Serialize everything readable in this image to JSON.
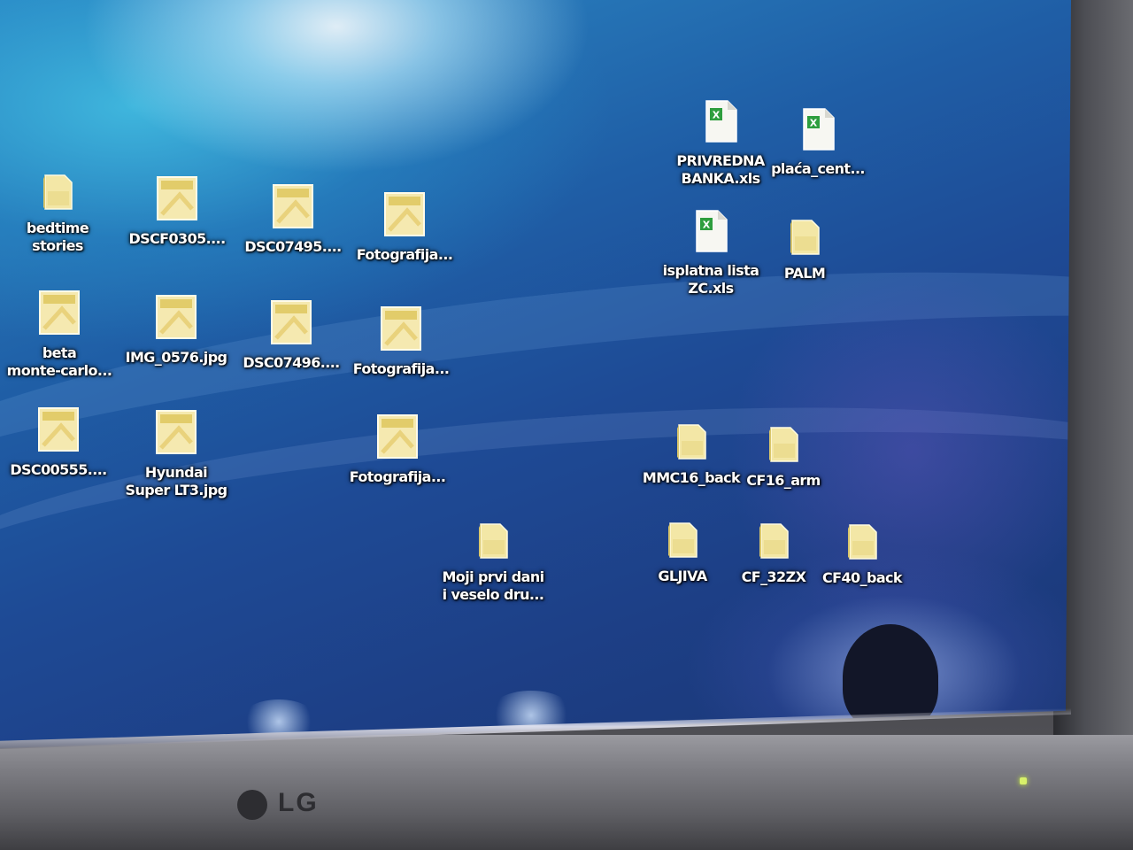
{
  "desktop": {
    "icons": [
      {
        "label": "bedtime\nstories",
        "type": "folder",
        "icon": "folder-icon"
      },
      {
        "label": "DSCF0305....",
        "type": "image",
        "icon": "image-file-icon"
      },
      {
        "label": "DSC07495....",
        "type": "image",
        "icon": "image-file-icon"
      },
      {
        "label": "Fotografija...",
        "type": "image",
        "icon": "image-file-icon"
      },
      {
        "label": "beta\nmonte-carlo...",
        "type": "image",
        "icon": "image-file-icon"
      },
      {
        "label": "IMG_0576.jpg",
        "type": "image",
        "icon": "image-file-icon"
      },
      {
        "label": "DSC07496....",
        "type": "image",
        "icon": "image-file-icon"
      },
      {
        "label": "Fotografija...",
        "type": "image",
        "icon": "image-file-icon"
      },
      {
        "label": "DSC00555....",
        "type": "image",
        "icon": "image-file-icon"
      },
      {
        "label": "Hyundai\nSuper LT3.jpg",
        "type": "image",
        "icon": "image-file-icon"
      },
      {
        "label": "Fotografija...",
        "type": "image",
        "icon": "image-file-icon"
      },
      {
        "label": "Moji prvi dani\ni veselo dru...",
        "type": "folder",
        "icon": "folder-icon"
      },
      {
        "label": "PRIVREDNA\nBANKA.xls",
        "type": "excel",
        "icon": "excel-file-icon"
      },
      {
        "label": "plaća_cent...",
        "type": "excel",
        "icon": "excel-file-icon"
      },
      {
        "label": "isplatna lista\nZC.xls",
        "type": "excel",
        "icon": "excel-file-icon"
      },
      {
        "label": "PALM",
        "type": "folder",
        "icon": "folder-icon"
      },
      {
        "label": "MMC16_back",
        "type": "folder",
        "icon": "folder-icon"
      },
      {
        "label": "CF16_arm",
        "type": "folder",
        "icon": "folder-icon"
      },
      {
        "label": "GLJIVA",
        "type": "folder",
        "icon": "folder-icon"
      },
      {
        "label": "CF_32ZX",
        "type": "folder",
        "icon": "folder-icon"
      },
      {
        "label": "CF40_back",
        "type": "folder",
        "icon": "folder-icon"
      }
    ]
  },
  "monitor": {
    "brand": "LG"
  },
  "colors": {
    "folder": "#f3e7a6",
    "image": "#f5e9b0",
    "excel_badge": "#2e9e3e"
  }
}
